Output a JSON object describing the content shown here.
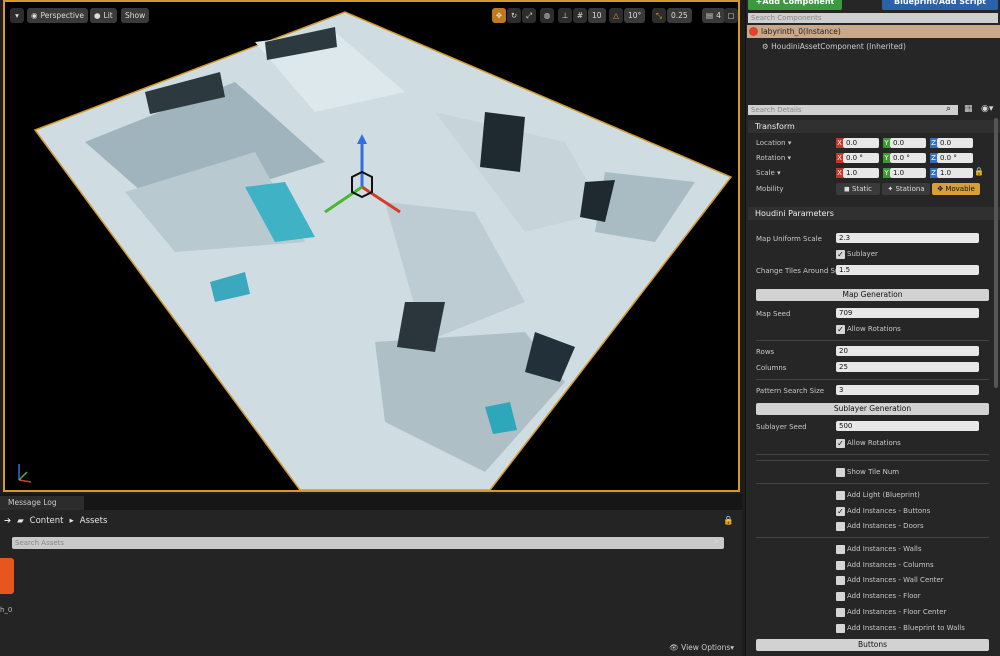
{
  "viewport": {
    "buttons": {
      "menu": "▾",
      "perspective": "Perspective",
      "lit": "Lit",
      "show": "Show"
    },
    "right_toolbar": {
      "grid_snap": "10",
      "rot_snap": "10°",
      "scale_snap": "0.25",
      "cam_speed": "4"
    }
  },
  "bottom": {
    "tab_label": "Message Log",
    "crumb_content": "Content",
    "crumb_assets": "Assets",
    "search_placeholder": "Search Assets",
    "asset_name": "h_0",
    "view_options": "View Options"
  },
  "components": {
    "add_button": "+Add Component",
    "blueprint_button": "Blueprint/Add Script",
    "search_placeholder": "Search Components",
    "instance": "labyrinth_0(Instance)",
    "child": "HoudiniAssetComponent (Inherited)"
  },
  "details": {
    "search_placeholder": "Search Details",
    "transform": {
      "title": "Transform",
      "location_label": "Location",
      "rotation_label": "Rotation",
      "scale_label": "Scale",
      "mobility_label": "Mobility",
      "location": [
        "0.0",
        "0.0",
        "0.0"
      ],
      "rotation": [
        "0.0 °",
        "0.0 °",
        "0.0 °"
      ],
      "scale": [
        "1.0",
        "1.0",
        "1.0"
      ],
      "mobility": [
        "Static",
        "Stationa",
        "Movable"
      ]
    },
    "houdini": {
      "title": "Houdini Parameters",
      "map_uniform_scale_label": "Map Uniform Scale",
      "map_uniform_scale": "2.3",
      "sublayer_label": "Sublayer",
      "change_tiles_label": "Change Tiles Around Su",
      "change_tiles": "1.5",
      "map_generation": "Map Generation",
      "map_seed_label": "Map Seed",
      "map_seed": "709",
      "allow_rotations": "Allow Rotations",
      "rows_label": "Rows",
      "rows": "20",
      "columns_label": "Columns",
      "columns": "25",
      "pattern_label": "Pattern Search Size",
      "pattern": "3",
      "sublayer_generation": "Sublayer Generation",
      "sublayer_seed_label": "Sublayer Seed",
      "sublayer_seed": "500",
      "allow_rotations_2": "Allow Rotations",
      "show_tile_num": "Show Tile Num",
      "add_light": "Add Light (Blueprint)",
      "add_buttons": "Add Instances - Buttons",
      "add_doors": "Add Instances - Doors",
      "add_walls": "Add Instances - Walls",
      "add_columns": "Add Instances - Columns",
      "add_wall_center": "Add Instances - Wall Center",
      "add_floor": "Add Instances - Floor",
      "add_floor_center": "Add Instances - Floor Center",
      "add_bp_walls": "Add Instances - Blueprint to Walls",
      "buttons": "Buttons"
    }
  },
  "axis_labels": {
    "x": "X",
    "y": "Y",
    "z": "Z"
  }
}
